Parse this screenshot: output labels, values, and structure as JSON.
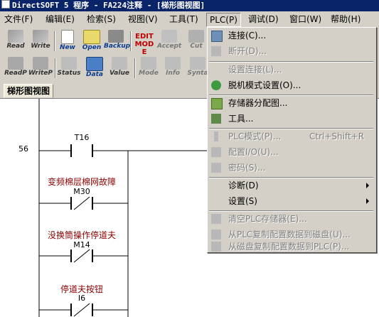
{
  "window": {
    "title": "DirectSOFT 5 程序 - FA224注释 - [梯形图视图]"
  },
  "menubar": [
    {
      "label": "文件(F)"
    },
    {
      "label": "编辑(E)"
    },
    {
      "label": "检索(S)"
    },
    {
      "label": "视图(V)"
    },
    {
      "label": "工具(T)"
    },
    {
      "label": "PLC(P)"
    },
    {
      "label": "调试(D)"
    },
    {
      "label": "窗口(W)"
    },
    {
      "label": "帮助(H)"
    }
  ],
  "toolbar1": [
    {
      "label": "Read"
    },
    {
      "label": "Write"
    },
    {
      "label": "New"
    },
    {
      "label": "Open"
    },
    {
      "label": "Backup"
    },
    {
      "label": "EDIT MODE"
    },
    {
      "label": "Accept"
    },
    {
      "label": "Cut"
    }
  ],
  "toolbar2": [
    {
      "label": "ReadP"
    },
    {
      "label": "WriteP"
    },
    {
      "label": "Status"
    },
    {
      "label": "Data"
    },
    {
      "label": "Value"
    },
    {
      "label": "Mode"
    },
    {
      "label": "Info"
    },
    {
      "label": "Synta"
    }
  ],
  "tabs": [
    {
      "label": "梯形图视图"
    }
  ],
  "ladder": {
    "rung_number": "56",
    "contacts": [
      {
        "address": "T16",
        "comment": ""
      },
      {
        "address": "M30",
        "comment": "变频棉层棉网故障"
      },
      {
        "address": "M14",
        "comment": "没换筒操作停道夫"
      },
      {
        "address": "I6",
        "comment": "停道夫按钮"
      }
    ]
  },
  "plc_menu": {
    "items": [
      {
        "label": "连接(C)...",
        "shortcut": "",
        "enabled": true,
        "icon": "connect-icon",
        "submenu": false
      },
      {
        "label": "断开(D)...",
        "shortcut": "",
        "enabled": false,
        "icon": "disconnect-icon",
        "submenu": false
      },
      {
        "label": "设置连接(L)...",
        "shortcut": "",
        "enabled": false,
        "icon": "",
        "submenu": false
      },
      {
        "label": "脱机模式设置(O)...",
        "shortcut": "",
        "enabled": true,
        "icon": "offline-mode-icon",
        "submenu": false
      },
      {
        "label": "存储器分配图...",
        "shortcut": "",
        "enabled": true,
        "icon": "memory-map-icon",
        "submenu": false
      },
      {
        "label": "工具...",
        "shortcut": "",
        "enabled": true,
        "icon": "tools-icon",
        "submenu": false
      },
      {
        "label": "PLC模式(P)...",
        "shortcut": "Ctrl+Shift+R",
        "enabled": false,
        "icon": "plc-mode-icon",
        "submenu": false
      },
      {
        "label": "配置I/O(U)...",
        "shortcut": "",
        "enabled": false,
        "icon": "configure-io-icon",
        "submenu": false
      },
      {
        "label": "密码(S)...",
        "shortcut": "",
        "enabled": false,
        "icon": "password-icon",
        "submenu": false
      },
      {
        "label": "诊断(D)",
        "shortcut": "",
        "enabled": true,
        "icon": "",
        "submenu": true
      },
      {
        "label": "设置(S)",
        "shortcut": "",
        "enabled": true,
        "icon": "",
        "submenu": true
      },
      {
        "label": "清空PLC存储器(E)...",
        "shortcut": "",
        "enabled": false,
        "icon": "clear-memory-icon",
        "submenu": false
      },
      {
        "label": "从PLC复制配置数据到磁盘(U)...",
        "shortcut": "",
        "enabled": false,
        "icon": "copy-to-disk-icon",
        "submenu": false
      },
      {
        "label": "从磁盘复制配置数据到PLC(P)...",
        "shortcut": "",
        "enabled": false,
        "icon": "copy-to-plc-icon",
        "submenu": false
      }
    ]
  },
  "colors": {
    "title_bar": "#0a246a",
    "comment_text": "#8b0000",
    "disabled_text": "#808080"
  }
}
